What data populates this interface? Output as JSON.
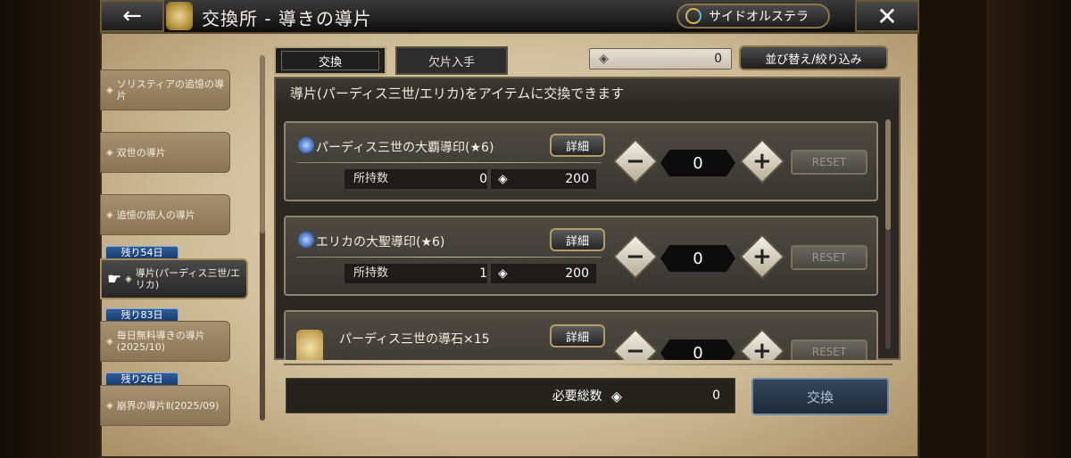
{
  "header": {
    "title": "交換所 - 導きの導片",
    "back_icon": "←",
    "close_icon": "✕",
    "oracle_button": "サイドオルステラ"
  },
  "categories": [
    {
      "label": "ソリスティアの追憶の導片",
      "badge": ""
    },
    {
      "label": "双世の導片",
      "badge": ""
    },
    {
      "label": "追憶の旅人の導片",
      "badge": ""
    },
    {
      "label": "導片(パーディス三世/エリカ)",
      "badge": "残り54日",
      "selected": true
    },
    {
      "label": "毎日無料導きの導片(2025/10)",
      "badge": "残り83日"
    },
    {
      "label": "崩界の導片Ⅱ(2025/09)",
      "badge": "残り26日"
    }
  ],
  "tabs": [
    {
      "label": "交換",
      "active": true
    },
    {
      "label": "欠片入手",
      "active": false
    }
  ],
  "currency_total": "0",
  "sort_button": "並び替え/絞り込み",
  "panel_header": "導片(パーディス三世/エリカ)をアイテムに交換できます",
  "items": [
    {
      "name": "パーディス三世の大覇導印(★6)",
      "detail": "詳細",
      "owned_label": "所持数",
      "owned": "0",
      "cost": "200",
      "qty": "0",
      "reset": "RESET"
    },
    {
      "name": "エリカの大聖導印(★6)",
      "detail": "詳細",
      "owned_label": "所持数",
      "owned": "1",
      "cost": "200",
      "qty": "0",
      "reset": "RESET"
    },
    {
      "name": "パーディス三世の導石×15",
      "detail": "詳細",
      "qty": "0",
      "reset": "RESET"
    }
  ],
  "footer": {
    "required_total_label": "必要総数",
    "required_total": "0",
    "exchange_button": "交換"
  },
  "colors": {
    "accent_gold": "#b49b67",
    "exchange_blue": "#35475a",
    "badge_blue": "#2f5c9a"
  }
}
